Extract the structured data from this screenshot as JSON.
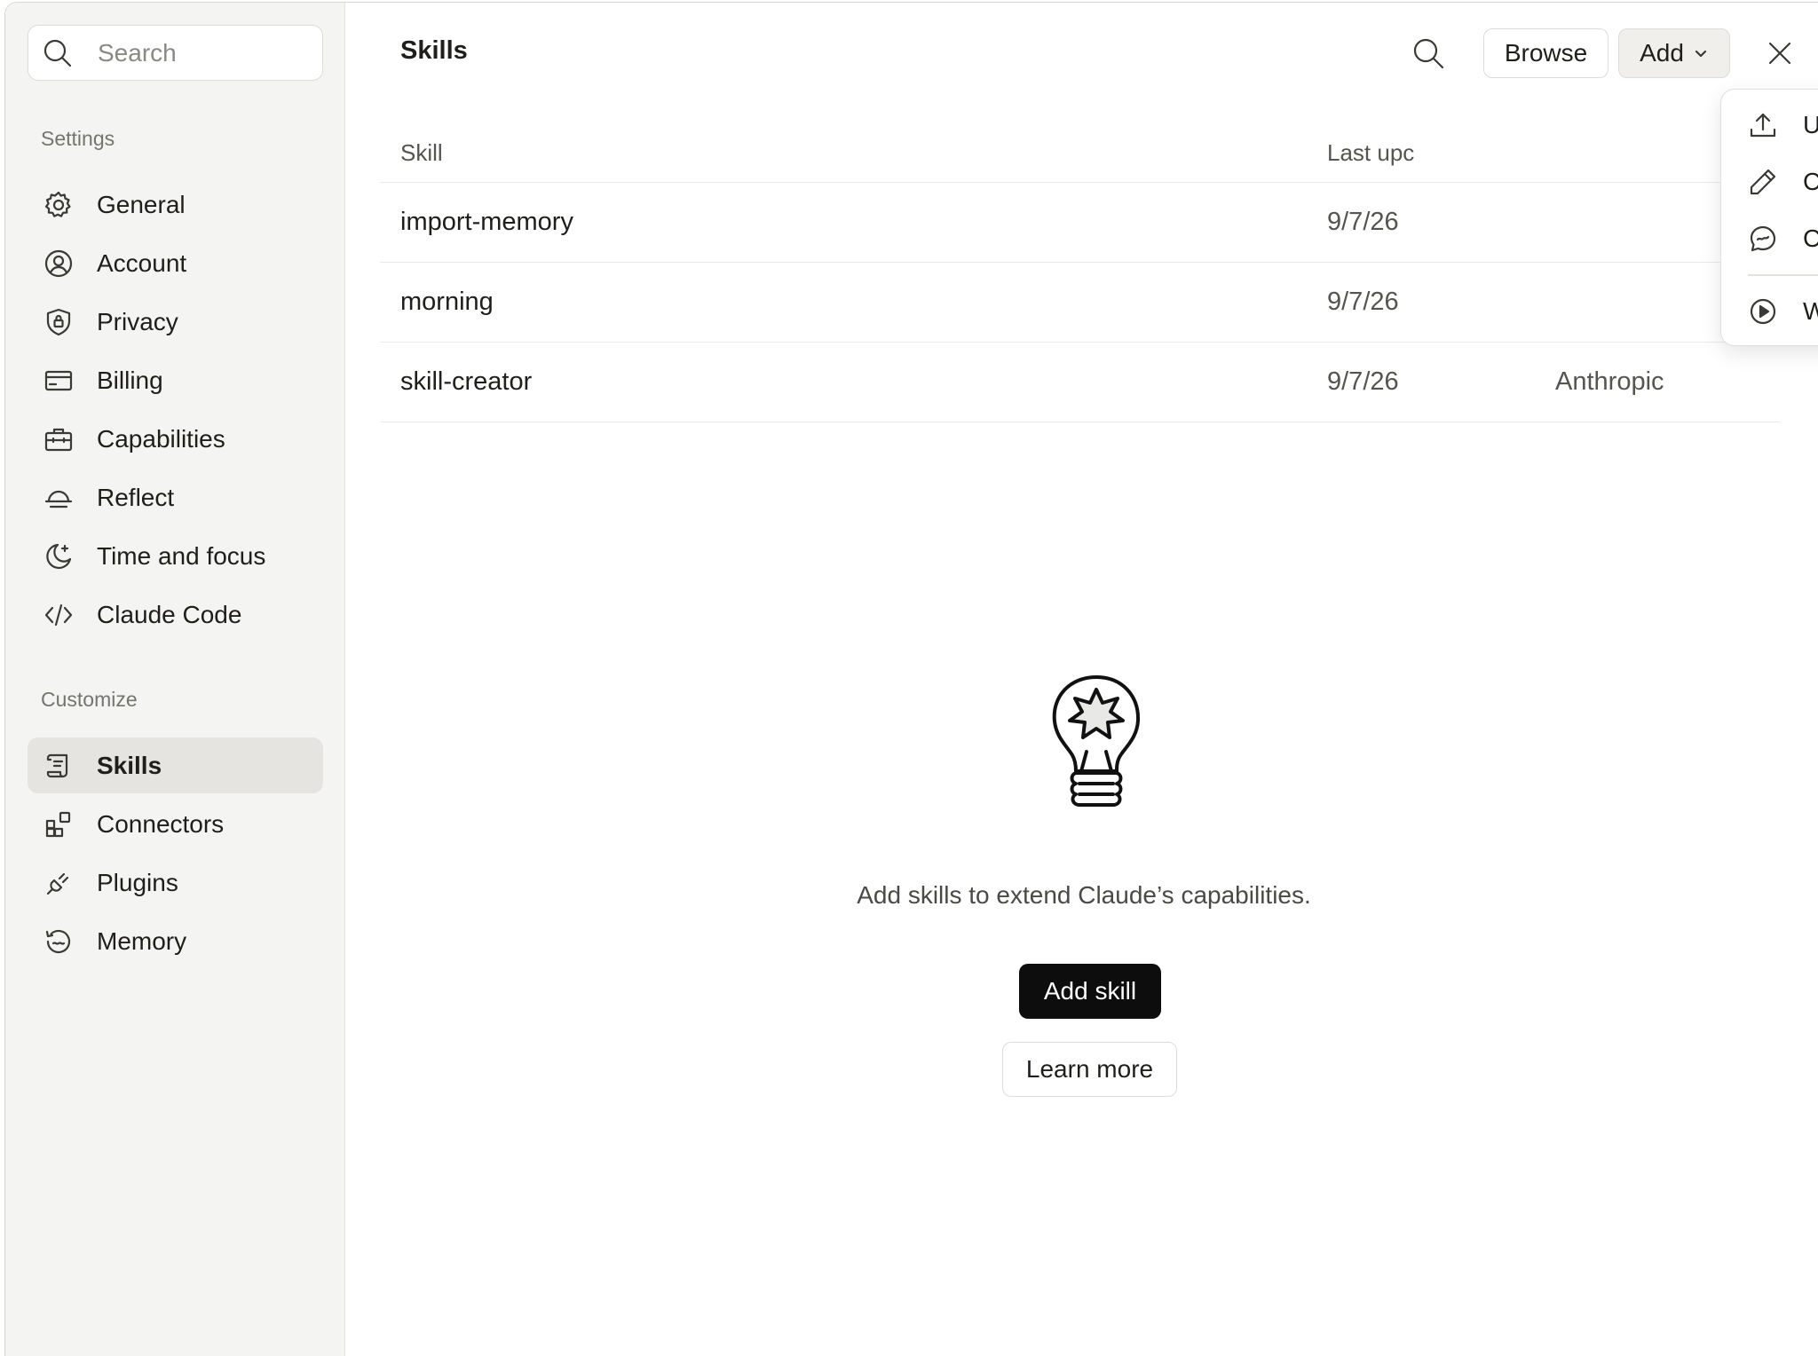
{
  "sidebar": {
    "search_placeholder": "Search",
    "sections": [
      {
        "label": "Settings"
      },
      {
        "label": "Customize"
      }
    ],
    "settings_items": [
      {
        "label": "General",
        "icon": "gear-icon"
      },
      {
        "label": "Account",
        "icon": "user-circle-icon"
      },
      {
        "label": "Privacy",
        "icon": "shield-lock-icon"
      },
      {
        "label": "Billing",
        "icon": "credit-card-icon"
      },
      {
        "label": "Capabilities",
        "icon": "briefcase-icon"
      },
      {
        "label": "Reflect",
        "icon": "sunset-icon"
      },
      {
        "label": "Time and focus",
        "icon": "moon-sparkle-icon"
      },
      {
        "label": "Claude Code",
        "icon": "code-icon"
      }
    ],
    "customize_items": [
      {
        "label": "Skills",
        "icon": "scroll-icon",
        "active": true
      },
      {
        "label": "Connectors",
        "icon": "blocks-icon"
      },
      {
        "label": "Plugins",
        "icon": "plug-icon"
      },
      {
        "label": "Memory",
        "icon": "memory-icon"
      }
    ]
  },
  "header": {
    "title": "Skills",
    "browse_label": "Browse",
    "add_label": "Add"
  },
  "table": {
    "columns": [
      "Skill",
      "Last upc"
    ],
    "rows": [
      {
        "name": "import-memory",
        "updated": "9/7/26",
        "author": ""
      },
      {
        "name": "morning",
        "updated": "9/7/26",
        "author": ""
      },
      {
        "name": "skill-creator",
        "updated": "9/7/26",
        "author": "Anthropic"
      }
    ]
  },
  "empty_state": {
    "message": "Add skills to extend Claude’s capabilities.",
    "primary_label": "Add skill",
    "secondary_label": "Learn more"
  },
  "add_menu": {
    "items": [
      {
        "label": "Upload skill",
        "icon": "upload-icon"
      },
      {
        "label": "Create a skill",
        "icon": "pencil-icon"
      },
      {
        "label": "Create with Claude",
        "icon": "chat-bubble-icon"
      },
      {
        "label": "Watch the intro video",
        "icon": "play-circle-icon"
      }
    ]
  },
  "colors": {
    "sidebar_bg": "#f4f4f2",
    "active_item_bg": "#e5e4e0",
    "primary_button": "#0d0d0d",
    "text": "#1f1e1b"
  }
}
